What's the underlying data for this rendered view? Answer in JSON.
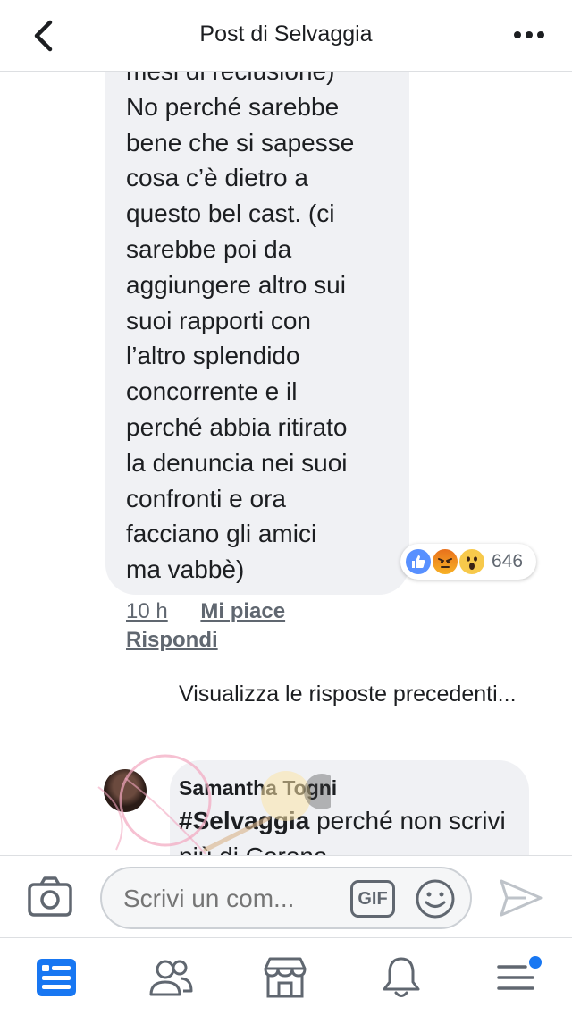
{
  "header": {
    "title": "Post di Selvaggia",
    "back_icon": "chevron-left-icon",
    "more_icon": "more-horizontal-icon"
  },
  "comment": {
    "text": "mesi di reclusione)\nNo perché sarebbe\nbene che si sapesse\ncosa c’è dietro a\nquesto bel cast. (ci\nsarebbe poi da\naggiungere altro sui\nsuoi rapporti con\nl’altro splendido\nconcorrente e il\nperché abbia ritirato\nla denuncia nei suoi\nconfronti e ora\nfacciano gli amici\nma vabbè)",
    "reactions_count": "646",
    "reaction_icons": [
      "like-icon",
      "angry-icon",
      "wow-icon"
    ],
    "time": "10 h",
    "like_label": "Mi piace",
    "reply_label": "Rispondi"
  },
  "previous_replies_label": "Visualizza le risposte precedenti...",
  "reply": {
    "author": "Samantha Togni",
    "hashtag": "#Selvaggia",
    "text_after": " perché non scrivi più di Corona"
  },
  "composer": {
    "placeholder": "Scrivi un com...",
    "gif_label": "GIF"
  },
  "colors": {
    "accent": "#1877f2",
    "bubble": "#f0f1f4",
    "secondary_text": "#606770"
  }
}
